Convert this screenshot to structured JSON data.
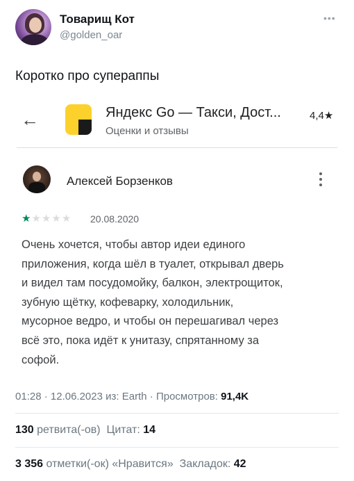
{
  "tweet": {
    "author_name": "Товарищ Кот",
    "author_handle": "@golden_oar",
    "more_icon": "more-horizontal-icon",
    "text": "Коротко про супераппы"
  },
  "embedded_screenshot": {
    "back_icon": "arrow-left-icon",
    "app_title": "Яндекс Go — Такси, Дост...",
    "app_subtitle": "Оценки и отзывы",
    "app_rating": "4,4★",
    "review": {
      "author": "Алексей Борзенков",
      "rating": 1,
      "rating_max": 5,
      "date": "20.08.2020",
      "text": "Очень хочется, чтобы автор идеи единого\nприложения, когда шёл в туалет, открывал дверь\nи видел там посудомойку, балкон, электрощиток,\nзубную щётку, кофеварку, холодильник,\nмусорное ведро, и чтобы он перешагивал через\nвсё это, пока идёт к унитазу, спрятанному за\nсофой."
    }
  },
  "meta": {
    "time": "01:28",
    "date": "12.06.2023",
    "source_prefix": "из:",
    "source": "Earth",
    "views_label": "Просмотров:",
    "views_value": "91,4K"
  },
  "stats": {
    "retweets_count": "130",
    "retweets_label": "ретвита(-ов)",
    "quotes_label": "Цитат:",
    "quotes_count": "14",
    "likes_count": "3 356",
    "likes_label": "отметки(-ок) «Нравится»",
    "bookmarks_label": "Закладок:",
    "bookmarks_count": "42"
  },
  "colors": {
    "star_filled": "#01875f",
    "app_icon_yellow": "#fdd12b"
  }
}
